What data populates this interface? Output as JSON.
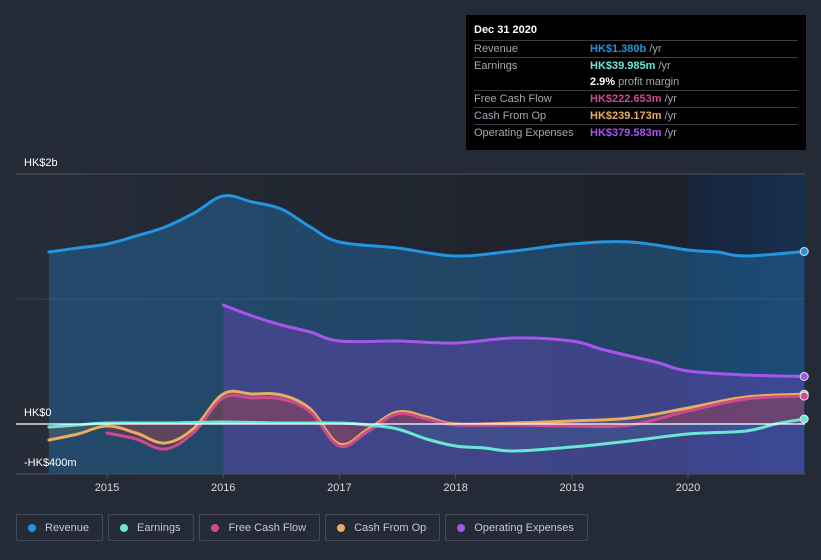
{
  "tooltip": {
    "date": "Dec 31 2020",
    "rows": [
      {
        "label": "Revenue",
        "value": "HK$1.380b",
        "unit": "/yr",
        "color": "#2394df"
      },
      {
        "label": "Earnings",
        "value": "HK$39.985m",
        "unit": "/yr",
        "color": "#6ae6d4"
      },
      {
        "label": "",
        "value": "2.9%",
        "unit": "profit margin",
        "color": "#ffffff"
      },
      {
        "label": "Free Cash Flow",
        "value": "HK$222.653m",
        "unit": "/yr",
        "color": "#cb4b8c"
      },
      {
        "label": "Cash From Op",
        "value": "HK$239.173m",
        "unit": "/yr",
        "color": "#e8ad5e"
      },
      {
        "label": "Operating Expenses",
        "value": "HK$379.583m",
        "unit": "/yr",
        "color": "#a855f0"
      }
    ]
  },
  "legend": [
    {
      "label": "Revenue",
      "color": "#2394df"
    },
    {
      "label": "Earnings",
      "color": "#6ae6d4"
    },
    {
      "label": "Free Cash Flow",
      "color": "#cb4b8c"
    },
    {
      "label": "Cash From Op",
      "color": "#e8ad5e"
    },
    {
      "label": "Operating Expenses",
      "color": "#a855f0"
    }
  ],
  "chart_data": {
    "type": "area",
    "title": "",
    "xlabel": "",
    "ylabel": "",
    "y_unit": "HK$m",
    "ylim": [
      -400,
      2000
    ],
    "xlim": [
      2014.25,
      2021.0
    ],
    "y_tick_labels": [
      {
        "value": 2000,
        "label": "HK$2b"
      },
      {
        "value": 0,
        "label": "HK$0"
      },
      {
        "value": -400,
        "label": "-HK$400m"
      }
    ],
    "gridline_values": [
      2000,
      1000
    ],
    "x_ticks": [
      2015,
      2016,
      2017,
      2018,
      2019,
      2020
    ],
    "x_tick_labels": [
      "2015",
      "2016",
      "2017",
      "2018",
      "2019",
      "2020"
    ],
    "highlight_range": [
      2020.0,
      2021.0
    ],
    "legend_position": "bottom",
    "series": [
      {
        "name": "Revenue",
        "color": "#2394df",
        "x": [
          2014.5,
          2014.75,
          2015.0,
          2015.25,
          2015.5,
          2015.75,
          2016.0,
          2016.25,
          2016.5,
          2016.75,
          2017.0,
          2017.5,
          2018.0,
          2018.5,
          2019.0,
          2019.5,
          2020.0,
          2020.25,
          2020.5,
          2021.0
        ],
        "values": [
          1376,
          1408,
          1440,
          1504,
          1576,
          1688,
          1824,
          1776,
          1720,
          1576,
          1456,
          1408,
          1344,
          1384,
          1440,
          1456,
          1392,
          1376,
          1344,
          1380
        ]
      },
      {
        "name": "Operating Expenses",
        "color": "#a855f0",
        "x": [
          2016.0,
          2016.25,
          2016.5,
          2016.75,
          2017.0,
          2017.5,
          2018.0,
          2018.5,
          2019.0,
          2019.25,
          2019.5,
          2019.75,
          2020.0,
          2020.5,
          2021.0
        ],
        "values": [
          952,
          864,
          792,
          736,
          664,
          664,
          648,
          688,
          664,
          600,
          544,
          488,
          424,
          392,
          380
        ]
      },
      {
        "name": "Cash From Op",
        "color": "#e8ad5e",
        "x": [
          2014.5,
          2014.75,
          2015.0,
          2015.25,
          2015.5,
          2015.75,
          2016.0,
          2016.25,
          2016.5,
          2016.75,
          2017.0,
          2017.25,
          2017.5,
          2017.75,
          2018.0,
          2018.5,
          2019.0,
          2019.5,
          2020.0,
          2020.5,
          2021.0
        ],
        "values": [
          -128,
          -80,
          -16,
          -72,
          -152,
          -32,
          240,
          240,
          232,
          120,
          -160,
          -40,
          96,
          56,
          0,
          8,
          24,
          48,
          128,
          216,
          239
        ]
      },
      {
        "name": "Free Cash Flow",
        "color": "#cb4b8c",
        "x": [
          2015.0,
          2015.25,
          2015.5,
          2015.75,
          2016.0,
          2016.25,
          2016.5,
          2016.75,
          2017.0,
          2017.25,
          2017.5,
          2017.75,
          2018.0,
          2018.5,
          2019.0,
          2019.5,
          2020.0,
          2020.5,
          2021.0
        ],
        "values": [
          -72,
          -120,
          -200,
          -64,
          208,
          208,
          200,
          96,
          -176,
          -56,
          80,
          40,
          -8,
          -8,
          -16,
          -8,
          104,
          200,
          223
        ]
      },
      {
        "name": "Earnings",
        "color": "#6ae6d4",
        "x": [
          2014.5,
          2014.75,
          2015.0,
          2015.5,
          2016.0,
          2016.5,
          2017.0,
          2017.25,
          2017.5,
          2017.75,
          2018.0,
          2018.25,
          2018.5,
          2019.0,
          2019.5,
          2020.0,
          2020.5,
          2020.75,
          2021.0
        ],
        "values": [
          -24,
          -8,
          8,
          8,
          16,
          8,
          8,
          -8,
          -40,
          -120,
          -176,
          -192,
          -216,
          -184,
          -136,
          -80,
          -56,
          0,
          40
        ]
      }
    ]
  }
}
